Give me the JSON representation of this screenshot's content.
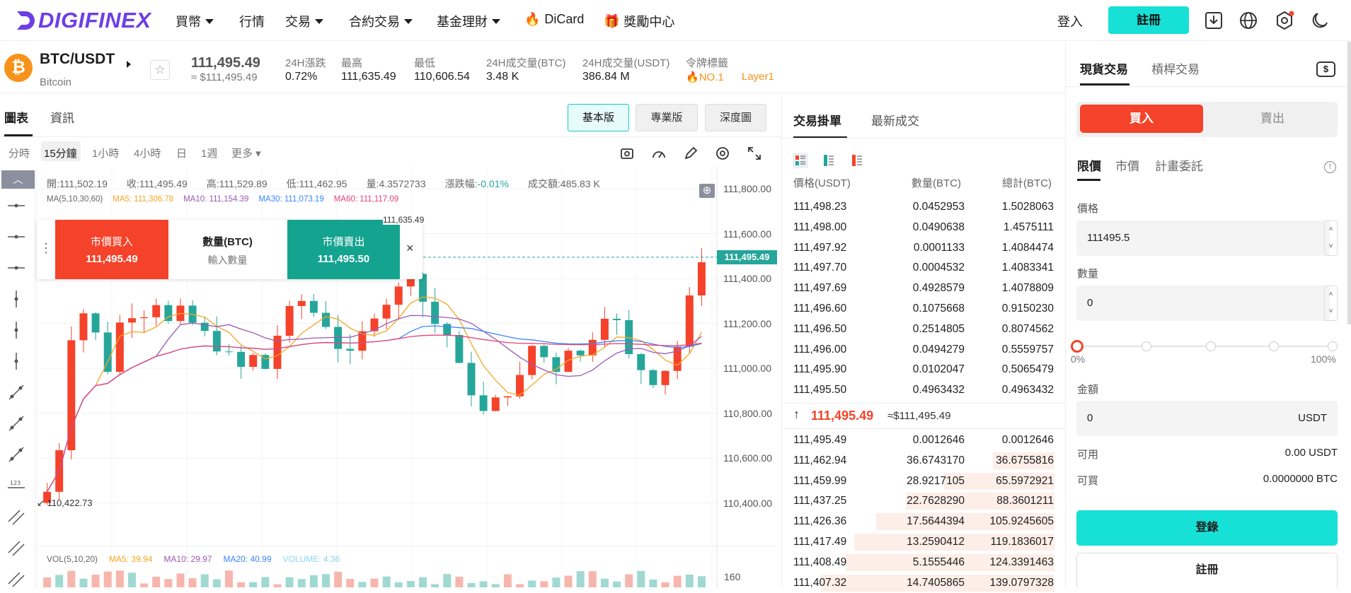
{
  "nav": {
    "logo": "DIGIFINEX",
    "items": [
      "買幣",
      "行情",
      "交易",
      "合約交易",
      "基金理財",
      "DiCard",
      "獎勵中心"
    ],
    "login": "登入",
    "register": "註冊"
  },
  "ticker": {
    "pair": "BTC/USDT",
    "name": "Bitcoin",
    "price": "111,495.49",
    "price_usd": "≈ $111,495.49",
    "stats": [
      {
        "label": "24H漲跌",
        "value": "0.72%"
      },
      {
        "label": "最高",
        "value": "111,635.49"
      },
      {
        "label": "最低",
        "value": "110,606.54"
      },
      {
        "label": "24H成交量(BTC)",
        "value": "3.48 K"
      },
      {
        "label": "24H成交量(USDT)",
        "value": "386.84 M"
      },
      {
        "label": "令牌標籤",
        "value": "NO.1"
      }
    ],
    "tag2": "Layer1",
    "colors": {
      "up": "#f5422a",
      "down": "#26a69a",
      "accent": "#17e0d6",
      "orange": "#f7931a"
    }
  },
  "chart_tabs": [
    "圖表",
    "資訊"
  ],
  "versions": [
    "基本版",
    "專業版",
    "深度圖"
  ],
  "timeframes": [
    "分時",
    "15分鐘",
    "1小時",
    "4小時",
    "日",
    "1週",
    "更多"
  ],
  "ohlc": {
    "open": "開:111,502.19",
    "close": "收:111,495.49",
    "high": "高:111,529.89",
    "low": "低:111,462.95",
    "vol": "量:4.3572733",
    "change_label": "漲跌幅:",
    "change": "-0.01%",
    "amount": "成交額:485.83 K"
  },
  "ma_legend": {
    "title": "MA(5,10,30,60)",
    "ma5": "MA5: 111,306.78",
    "ma10": "MA10: 111,154.39",
    "ma30": "MA30: 111,073.19",
    "ma60": "MA60: 111,117.09"
  },
  "quick_order": {
    "buy_label": "市價買入",
    "buy_price": "111,495.49",
    "qty_label": "數量(BTC)",
    "qty_placeholder": "輸入數量",
    "sell_label": "市價賣出",
    "sell_price": "111,495.50"
  },
  "price_axis": [
    "111,800.00",
    "111,600.00",
    "111,400.00",
    "111,200.00",
    "111,000.00",
    "110,800.00",
    "110,600.00",
    "110,400.00"
  ],
  "current_price_tag": "111,495.49",
  "high_marker": "111,635.49",
  "low_marker": "110,422.73",
  "vol_legend": {
    "title": "VOL(5,10,20)",
    "ma5": "MA5: 39.94",
    "ma10": "MA10: 29.97",
    "ma20": "MA20: 40.99",
    "volume": "VOLUME: 4.36"
  },
  "vol_axis": "160",
  "orderbook": {
    "tabs": [
      "交易掛單",
      "最新成交"
    ],
    "headers": [
      "價格(USDT)",
      "數量(BTC)",
      "總計(BTC)"
    ],
    "asks": [
      [
        "111,498.23",
        "0.0452953",
        "1.5028063"
      ],
      [
        "111,498.00",
        "0.0490638",
        "1.4575111"
      ],
      [
        "111,497.92",
        "0.0001133",
        "1.4084474"
      ],
      [
        "111,497.70",
        "0.0004532",
        "1.4083341"
      ],
      [
        "111,497.69",
        "0.4928579",
        "1.4078809"
      ],
      [
        "111,496.60",
        "0.1075668",
        "0.9150230"
      ],
      [
        "111,496.50",
        "0.2514805",
        "0.8074562"
      ],
      [
        "111,496.00",
        "0.0494279",
        "0.5559757"
      ],
      [
        "111,495.90",
        "0.0102047",
        "0.5065479"
      ],
      [
        "111,495.50",
        "0.4963432",
        "0.4963432"
      ]
    ],
    "mid_price": "111,495.49",
    "mid_usd": "≈$111,495.49",
    "bids": [
      [
        "111,495.49",
        "0.0012646",
        "0.0012646"
      ],
      [
        "111,462.94",
        "36.6743170",
        "36.6755816"
      ],
      [
        "111,459.99",
        "28.9217105",
        "65.5972921"
      ],
      [
        "111,437.25",
        "22.7628290",
        "88.3601211"
      ],
      [
        "111,426.36",
        "17.5644394",
        "105.9245605"
      ],
      [
        "111,417.49",
        "13.2590412",
        "119.1836017"
      ],
      [
        "111,408.49",
        "5.1555446",
        "124.3391463"
      ],
      [
        "111,407.32",
        "14.7405865",
        "139.0797328"
      ]
    ]
  },
  "trade": {
    "tabs": [
      "現貨交易",
      "槓桿交易"
    ],
    "buy": "買入",
    "sell": "賣出",
    "order_types": [
      "限價",
      "市價",
      "計畫委託"
    ],
    "price_label": "價格",
    "price_value": "111495.5",
    "qty_label": "數量",
    "qty_value": "0",
    "slider_min": "0%",
    "slider_max": "100%",
    "amount_label": "金額",
    "amount_value": "0",
    "amount_unit": "USDT",
    "available_label": "可用",
    "available_value": "0.00 USDT",
    "buyable_label": "可買",
    "buyable_value": "0.0000000 BTC",
    "login_btn": "登錄",
    "register_btn": "註冊"
  }
}
